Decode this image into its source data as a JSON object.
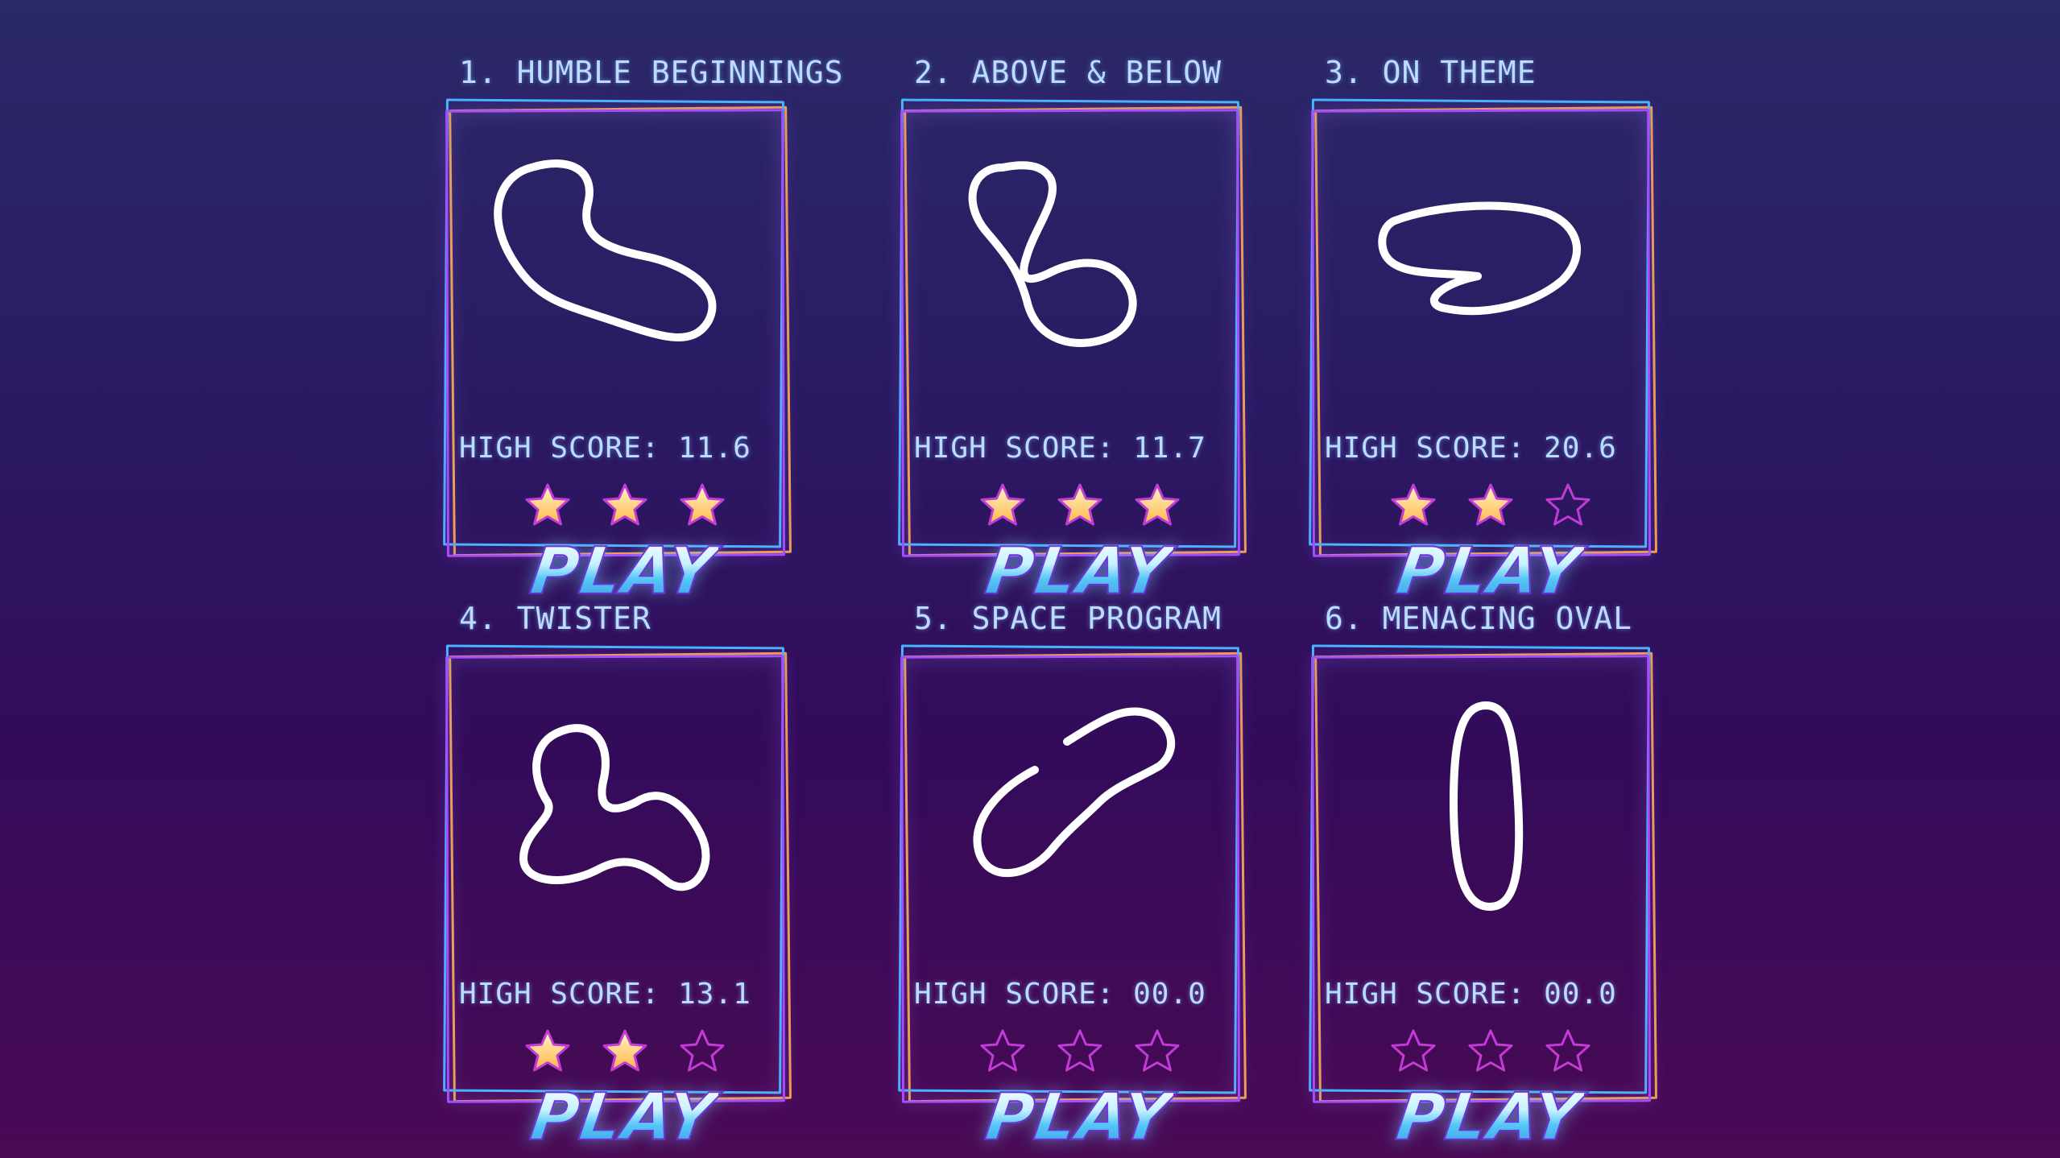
{
  "levels": [
    {
      "title": "1. HUMBLE BEGINNINGS",
      "high_score": "HIGH SCORE: 11.6",
      "stars": 3,
      "play": "PLAY"
    },
    {
      "title": "2. ABOVE & BELOW",
      "high_score": "HIGH SCORE: 11.7",
      "stars": 3,
      "play": "PLAY"
    },
    {
      "title": "3. ON THEME",
      "high_score": "HIGH SCORE: 20.6",
      "stars": 2,
      "play": "PLAY"
    },
    {
      "title": "4. TWISTER",
      "high_score": "HIGH SCORE: 13.1",
      "stars": 2,
      "play": "PLAY"
    },
    {
      "title": "5. SPACE PROGRAM",
      "high_score": "HIGH SCORE: 00.0",
      "stars": 0,
      "play": "PLAY"
    },
    {
      "title": "6. MENACING OVAL",
      "high_score": "HIGH SCORE: 00.0",
      "stars": 0,
      "play": "PLAY"
    }
  ],
  "max_stars": 3,
  "colors": {
    "text": "#b9dcff",
    "star_filled": "#ffd36a",
    "star_empty": "#c23bd6",
    "frame_orange": "#f0a24b",
    "frame_blue": "#45b7ff",
    "frame_purple": "#a34dff"
  }
}
